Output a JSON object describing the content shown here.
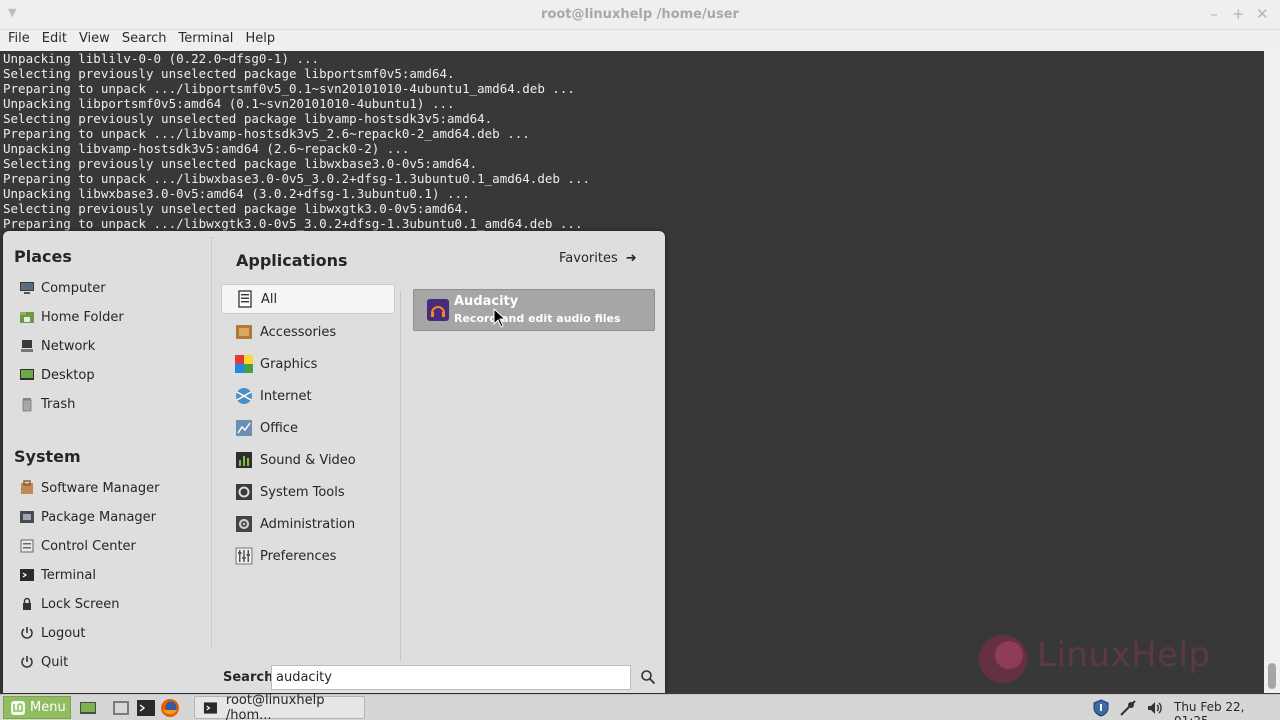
{
  "window": {
    "title": "root@linuxhelp /home/user",
    "menu": [
      "File",
      "Edit",
      "View",
      "Search",
      "Terminal",
      "Help"
    ]
  },
  "terminal": {
    "lines": [
      "Unpacking liblilv-0-0 (0.22.0~dfsg0-1) ...",
      "Selecting previously unselected package libportsmf0v5:amd64.",
      "Preparing to unpack .../libportsmf0v5_0.1~svn20101010-4ubuntu1_amd64.deb ...",
      "Unpacking libportsmf0v5:amd64 (0.1~svn20101010-4ubuntu1) ...",
      "Selecting previously unselected package libvamp-hostsdk3v5:amd64.",
      "Preparing to unpack .../libvamp-hostsdk3v5_2.6~repack0-2_amd64.deb ...",
      "Unpacking libvamp-hostsdk3v5:amd64 (2.6~repack0-2) ...",
      "Selecting previously unselected package libwxbase3.0-0v5:amd64.",
      "Preparing to unpack .../libwxbase3.0-0v5_3.0.2+dfsg-1.3ubuntu0.1_amd64.deb ...",
      "Unpacking libwxbase3.0-0v5:amd64 (3.0.2+dfsg-1.3ubuntu0.1) ...",
      "Selecting previously unselected package libwxgtk3.0-0v5:amd64.",
      "Preparing to unpack .../libwxgtk3.0-0v5_3.0.2+dfsg-1.3ubuntu0.1_amd64.deb ..."
    ]
  },
  "start_menu": {
    "places_title": "Places",
    "places": [
      {
        "label": "Computer",
        "icon": "computer-icon"
      },
      {
        "label": "Home Folder",
        "icon": "home-folder-icon"
      },
      {
        "label": "Network",
        "icon": "network-icon"
      },
      {
        "label": "Desktop",
        "icon": "desktop-icon"
      },
      {
        "label": "Trash",
        "icon": "trash-icon"
      }
    ],
    "system_title": "System",
    "system": [
      {
        "label": "Software Manager",
        "icon": "software-manager-icon"
      },
      {
        "label": "Package Manager",
        "icon": "package-manager-icon"
      },
      {
        "label": "Control Center",
        "icon": "control-center-icon"
      },
      {
        "label": "Terminal",
        "icon": "terminal-icon"
      },
      {
        "label": "Lock Screen",
        "icon": "lock-icon"
      },
      {
        "label": "Logout",
        "icon": "logout-icon"
      },
      {
        "label": "Quit",
        "icon": "power-icon"
      }
    ],
    "applications_title": "Applications",
    "favorites_label": "Favorites",
    "categories": [
      {
        "label": "All",
        "icon": "all-icon",
        "selected": true
      },
      {
        "label": "Accessories",
        "icon": "accessories-icon"
      },
      {
        "label": "Graphics",
        "icon": "graphics-icon"
      },
      {
        "label": "Internet",
        "icon": "internet-icon"
      },
      {
        "label": "Office",
        "icon": "office-icon"
      },
      {
        "label": "Sound & Video",
        "icon": "sound-video-icon"
      },
      {
        "label": "System Tools",
        "icon": "system-tools-icon"
      },
      {
        "label": "Administration",
        "icon": "administration-icon"
      },
      {
        "label": "Preferences",
        "icon": "preferences-icon"
      }
    ],
    "result": {
      "name": "Audacity",
      "description": "Record and edit audio files",
      "icon": "audacity-icon"
    },
    "search_label": "Search:",
    "search_value": "audacity"
  },
  "panel": {
    "menu_label": "Menu",
    "task_label": "root@linuxhelp /hom...",
    "clock": "Thu Feb 22, 01:25"
  },
  "watermark": {
    "text": "LinuxHelp"
  },
  "colors": {
    "terminal_bg": "#383838",
    "menu_bg": "#dedede",
    "menu_button": "#8fbd60",
    "result_highlight": "#a6a6a6"
  }
}
